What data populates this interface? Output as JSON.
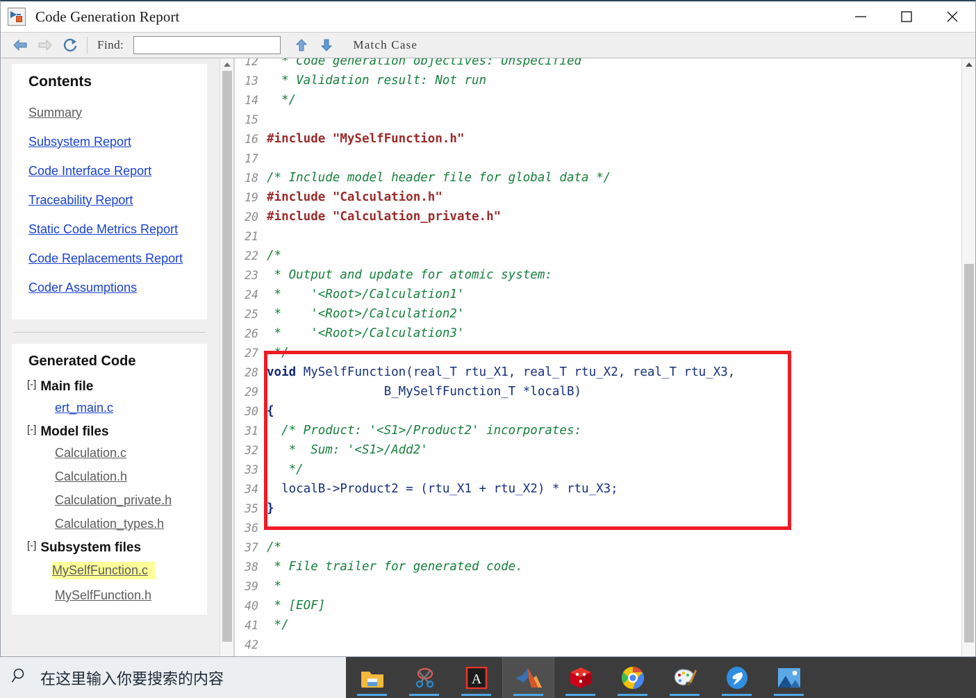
{
  "window": {
    "title": "Code Generation Report",
    "app_icon": "simulink-icon",
    "controls": {
      "minimize": "minimize-icon",
      "maximize": "maximize-icon",
      "close": "close-icon"
    }
  },
  "toolbar": {
    "back": "back-arrow-icon",
    "forward": "forward-arrow-icon",
    "refresh": "refresh-icon",
    "find_label": "Find:",
    "find_value": "",
    "find_placeholder": "",
    "find_prev": "up-arrow-icon",
    "find_next": "down-arrow-icon",
    "match_case_label": "Match Case"
  },
  "sidebar": {
    "contents_heading": "Contents",
    "contents_links": [
      {
        "label": "Summary",
        "state": "visited"
      },
      {
        "label": "Subsystem Report",
        "state": "link"
      },
      {
        "label": "Code Interface Report",
        "state": "link"
      },
      {
        "label": "Traceability Report",
        "state": "link"
      },
      {
        "label": "Static Code Metrics Report",
        "state": "link"
      },
      {
        "label": "Code Replacements Report",
        "state": "link"
      },
      {
        "label": "Coder Assumptions",
        "state": "link"
      }
    ],
    "generated_heading": "Generated Code",
    "groups": [
      {
        "toggle": "[-]",
        "label": "Main file",
        "files": [
          {
            "name": "ert_main.c",
            "state": "link"
          }
        ]
      },
      {
        "toggle": "[-]",
        "label": "Model files",
        "files": [
          {
            "name": "Calculation.c",
            "state": "visited"
          },
          {
            "name": "Calculation.h",
            "state": "visited"
          },
          {
            "name": "Calculation_private.h",
            "state": "visited"
          },
          {
            "name": "Calculation_types.h",
            "state": "visited"
          }
        ]
      },
      {
        "toggle": "[-]",
        "label": "Subsystem files",
        "files": [
          {
            "name": "MySelfFunction.c",
            "state": "selected"
          },
          {
            "name": "MySelfFunction.h",
            "state": "visited"
          }
        ]
      }
    ]
  },
  "code": {
    "highlight_color": "#ef1c24",
    "first_visible_line": 12,
    "lines": [
      {
        "n": "12",
        "parts": [
          {
            "t": "  * Code generation objectives: Unspecified",
            "c": "cm"
          }
        ]
      },
      {
        "n": "13",
        "parts": [
          {
            "t": "  * Validation result: Not run",
            "c": "cm"
          }
        ]
      },
      {
        "n": "14",
        "parts": [
          {
            "t": "  */",
            "c": "cm"
          }
        ]
      },
      {
        "n": "15",
        "parts": [
          {
            "t": "",
            "c": ""
          }
        ]
      },
      {
        "n": "16",
        "parts": [
          {
            "t": "#include ",
            "c": "pp"
          },
          {
            "t": "\"MySelfFunction.h\"",
            "c": "str"
          }
        ]
      },
      {
        "n": "17",
        "parts": [
          {
            "t": "",
            "c": ""
          }
        ]
      },
      {
        "n": "18",
        "parts": [
          {
            "t": "/* Include model header file for global data */",
            "c": "cm"
          }
        ]
      },
      {
        "n": "19",
        "parts": [
          {
            "t": "#include ",
            "c": "pp"
          },
          {
            "t": "\"Calculation.h\"",
            "c": "str"
          }
        ]
      },
      {
        "n": "20",
        "parts": [
          {
            "t": "#include ",
            "c": "pp"
          },
          {
            "t": "\"Calculation_private.h\"",
            "c": "str"
          }
        ]
      },
      {
        "n": "21",
        "parts": [
          {
            "t": "",
            "c": ""
          }
        ]
      },
      {
        "n": "22",
        "parts": [
          {
            "t": "/*",
            "c": "cm"
          }
        ]
      },
      {
        "n": "23",
        "parts": [
          {
            "t": " * Output and update for atomic system:",
            "c": "cm"
          }
        ]
      },
      {
        "n": "24",
        "parts": [
          {
            "t": " *    '<Root>/Calculation1'",
            "c": "cm"
          }
        ]
      },
      {
        "n": "25",
        "parts": [
          {
            "t": " *    '<Root>/Calculation2'",
            "c": "cm"
          }
        ]
      },
      {
        "n": "26",
        "parts": [
          {
            "t": " *    '<Root>/Calculation3'",
            "c": "cm"
          }
        ]
      },
      {
        "n": "27",
        "parts": [
          {
            "t": " */",
            "c": "cm"
          }
        ]
      },
      {
        "n": "28",
        "parts": [
          {
            "t": "void",
            "c": "kw"
          },
          {
            "t": " MySelfFunction(real_T rtu_X1, real_T rtu_X2, real_T rtu_X3,",
            "c": "id"
          }
        ]
      },
      {
        "n": "29",
        "parts": [
          {
            "t": "                B_MySelfFunction_T *localB)",
            "c": "id"
          }
        ]
      },
      {
        "n": "30",
        "parts": [
          {
            "t": "{",
            "c": "kw"
          }
        ]
      },
      {
        "n": "31",
        "parts": [
          {
            "t": "  /* Product: '<S1>/Product2' incorporates:",
            "c": "cm"
          }
        ]
      },
      {
        "n": "32",
        "parts": [
          {
            "t": "   *  Sum: '<S1>/Add2'",
            "c": "cm"
          }
        ]
      },
      {
        "n": "33",
        "parts": [
          {
            "t": "   */",
            "c": "cm"
          }
        ]
      },
      {
        "n": "34",
        "parts": [
          {
            "t": "  localB->Product2 = (rtu_X1 + rtu_X2) * rtu_X3;",
            "c": "id"
          }
        ]
      },
      {
        "n": "35",
        "parts": [
          {
            "t": "}",
            "c": "kw"
          }
        ]
      },
      {
        "n": "36",
        "parts": [
          {
            "t": "",
            "c": ""
          }
        ]
      },
      {
        "n": "37",
        "parts": [
          {
            "t": "/*",
            "c": "cm"
          }
        ]
      },
      {
        "n": "38",
        "parts": [
          {
            "t": " * File trailer for generated code.",
            "c": "cm"
          }
        ]
      },
      {
        "n": "39",
        "parts": [
          {
            "t": " *",
            "c": "cm"
          }
        ]
      },
      {
        "n": "40",
        "parts": [
          {
            "t": " * [EOF]",
            "c": "cm"
          }
        ]
      },
      {
        "n": "41",
        "parts": [
          {
            "t": " */",
            "c": "cm"
          }
        ]
      },
      {
        "n": "42",
        "parts": [
          {
            "t": "",
            "c": ""
          }
        ]
      }
    ],
    "highlight_lines": [
      "28",
      "36"
    ]
  },
  "taskbar": {
    "search_placeholder": "在这里输入你要搜索的内容",
    "search_icon": "search-icon",
    "items": [
      {
        "name": "file-explorer",
        "active": false
      },
      {
        "name": "snipping-tool",
        "active": false
      },
      {
        "name": "adobe-acrobat",
        "active": false
      },
      {
        "name": "matlab",
        "active": true
      },
      {
        "name": "3d-cad-app",
        "active": false
      },
      {
        "name": "google-chrome",
        "active": false
      },
      {
        "name": "paint",
        "active": false
      },
      {
        "name": "dingtalk",
        "active": false
      },
      {
        "name": "photos",
        "active": false
      }
    ]
  }
}
